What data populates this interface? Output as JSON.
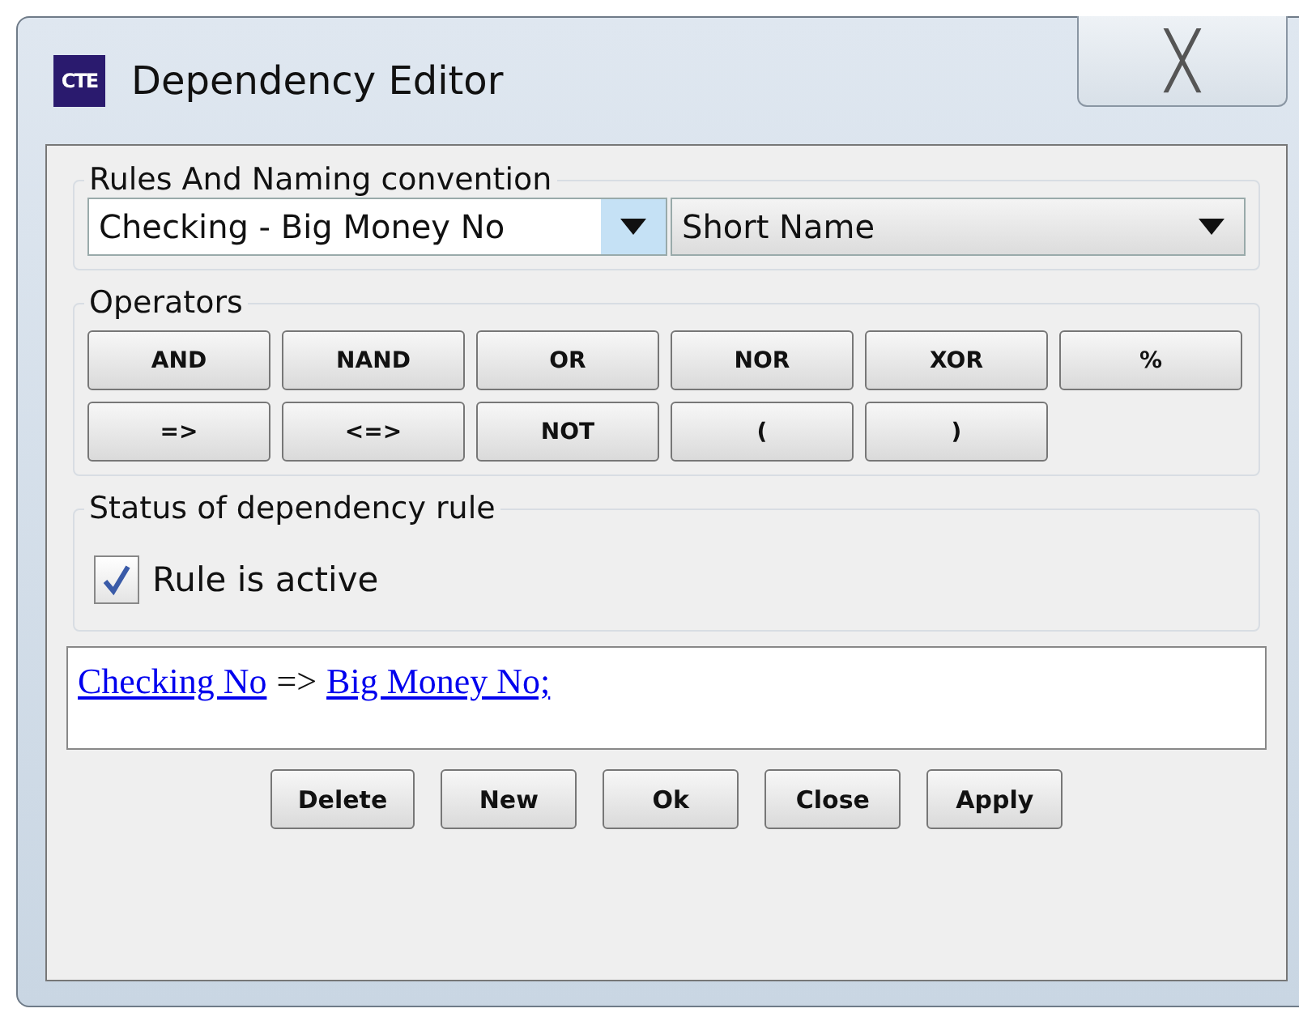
{
  "window": {
    "icon_text": "CTE",
    "title": "Dependency Editor",
    "close": "╳"
  },
  "rules_group": {
    "title": "Rules And Naming convention",
    "rule_select": {
      "value": "Checking - Big Money No",
      "focused": true
    },
    "naming_select": {
      "value": "Short Name",
      "focused": false
    }
  },
  "operators_group": {
    "title": "Operators",
    "buttons": [
      {
        "label": "AND"
      },
      {
        "label": "NAND"
      },
      {
        "label": "OR"
      },
      {
        "label": "NOR"
      },
      {
        "label": "XOR"
      },
      {
        "label": "%"
      },
      {
        "label": "=>"
      },
      {
        "label": "<=>"
      },
      {
        "label": "NOT"
      },
      {
        "label": "("
      },
      {
        "label": ")"
      }
    ]
  },
  "status_group": {
    "title": "Status of dependency rule",
    "checkbox": {
      "label": "Rule is active",
      "checked": true
    }
  },
  "rule_text": [
    {
      "kind": "link",
      "text": "Checking No"
    },
    {
      "kind": "text",
      "text": "=>"
    },
    {
      "kind": "link",
      "text": "Big Money No;"
    }
  ],
  "buttons": [
    "Delete",
    "New",
    "Ok",
    "Close",
    "Apply"
  ]
}
